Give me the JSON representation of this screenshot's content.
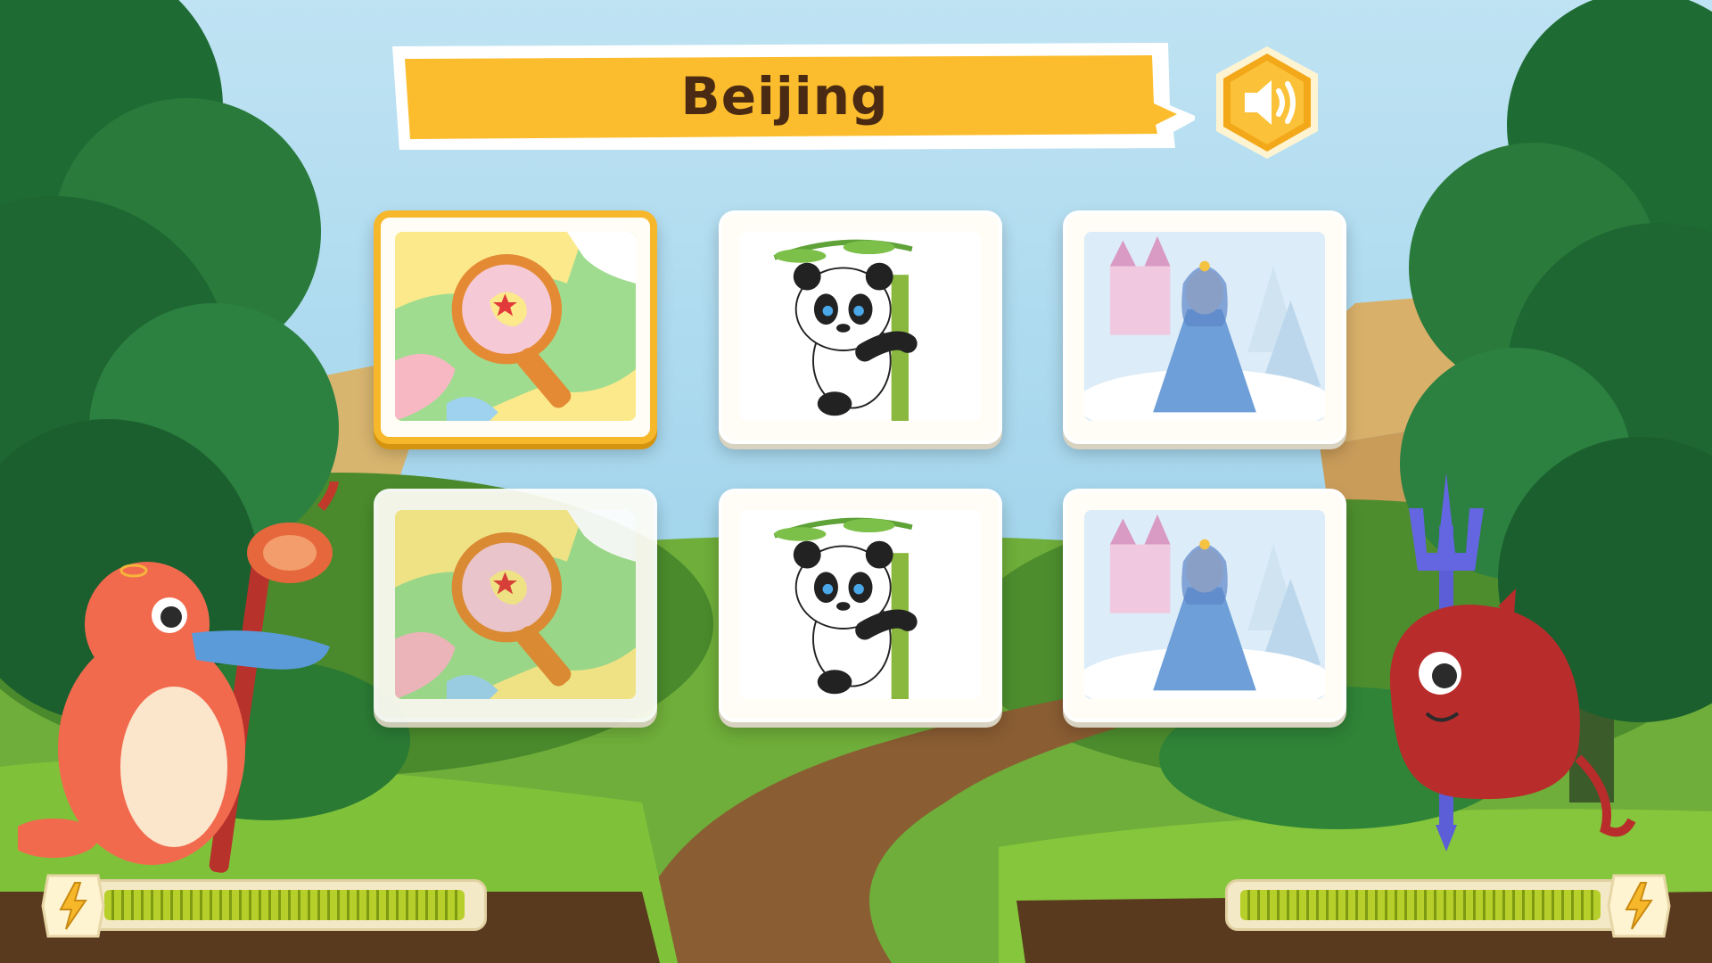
{
  "title": "Beijing",
  "icons": {
    "sound": "speaker-volume-icon",
    "player_energy": "lightning-bolt-icon",
    "opponent_energy": "lightning-bolt-icon"
  },
  "cards": [
    {
      "image": "china-map-magnifier",
      "row": 1,
      "col": 1,
      "state": "selected"
    },
    {
      "image": "panda-on-bamboo",
      "row": 1,
      "col": 2,
      "state": "normal"
    },
    {
      "image": "snow-princess-castle",
      "row": 1,
      "col": 3,
      "state": "normal"
    },
    {
      "image": "china-map-magnifier",
      "row": 2,
      "col": 1,
      "state": "dimmed"
    },
    {
      "image": "panda-on-bamboo",
      "row": 2,
      "col": 2,
      "state": "normal"
    },
    {
      "image": "snow-princess-castle",
      "row": 2,
      "col": 3,
      "state": "normal"
    }
  ],
  "player": {
    "character": "platypus-with-staff",
    "energy_fraction": 1.0
  },
  "opponent": {
    "character": "red-blob-with-trident",
    "energy_fraction": 1.0
  },
  "colors": {
    "banner": "#fbbd2e",
    "card_highlight": "#f6b82a",
    "energy_fill": "#b7cf2a",
    "energy_track": "#f4e9c6"
  }
}
